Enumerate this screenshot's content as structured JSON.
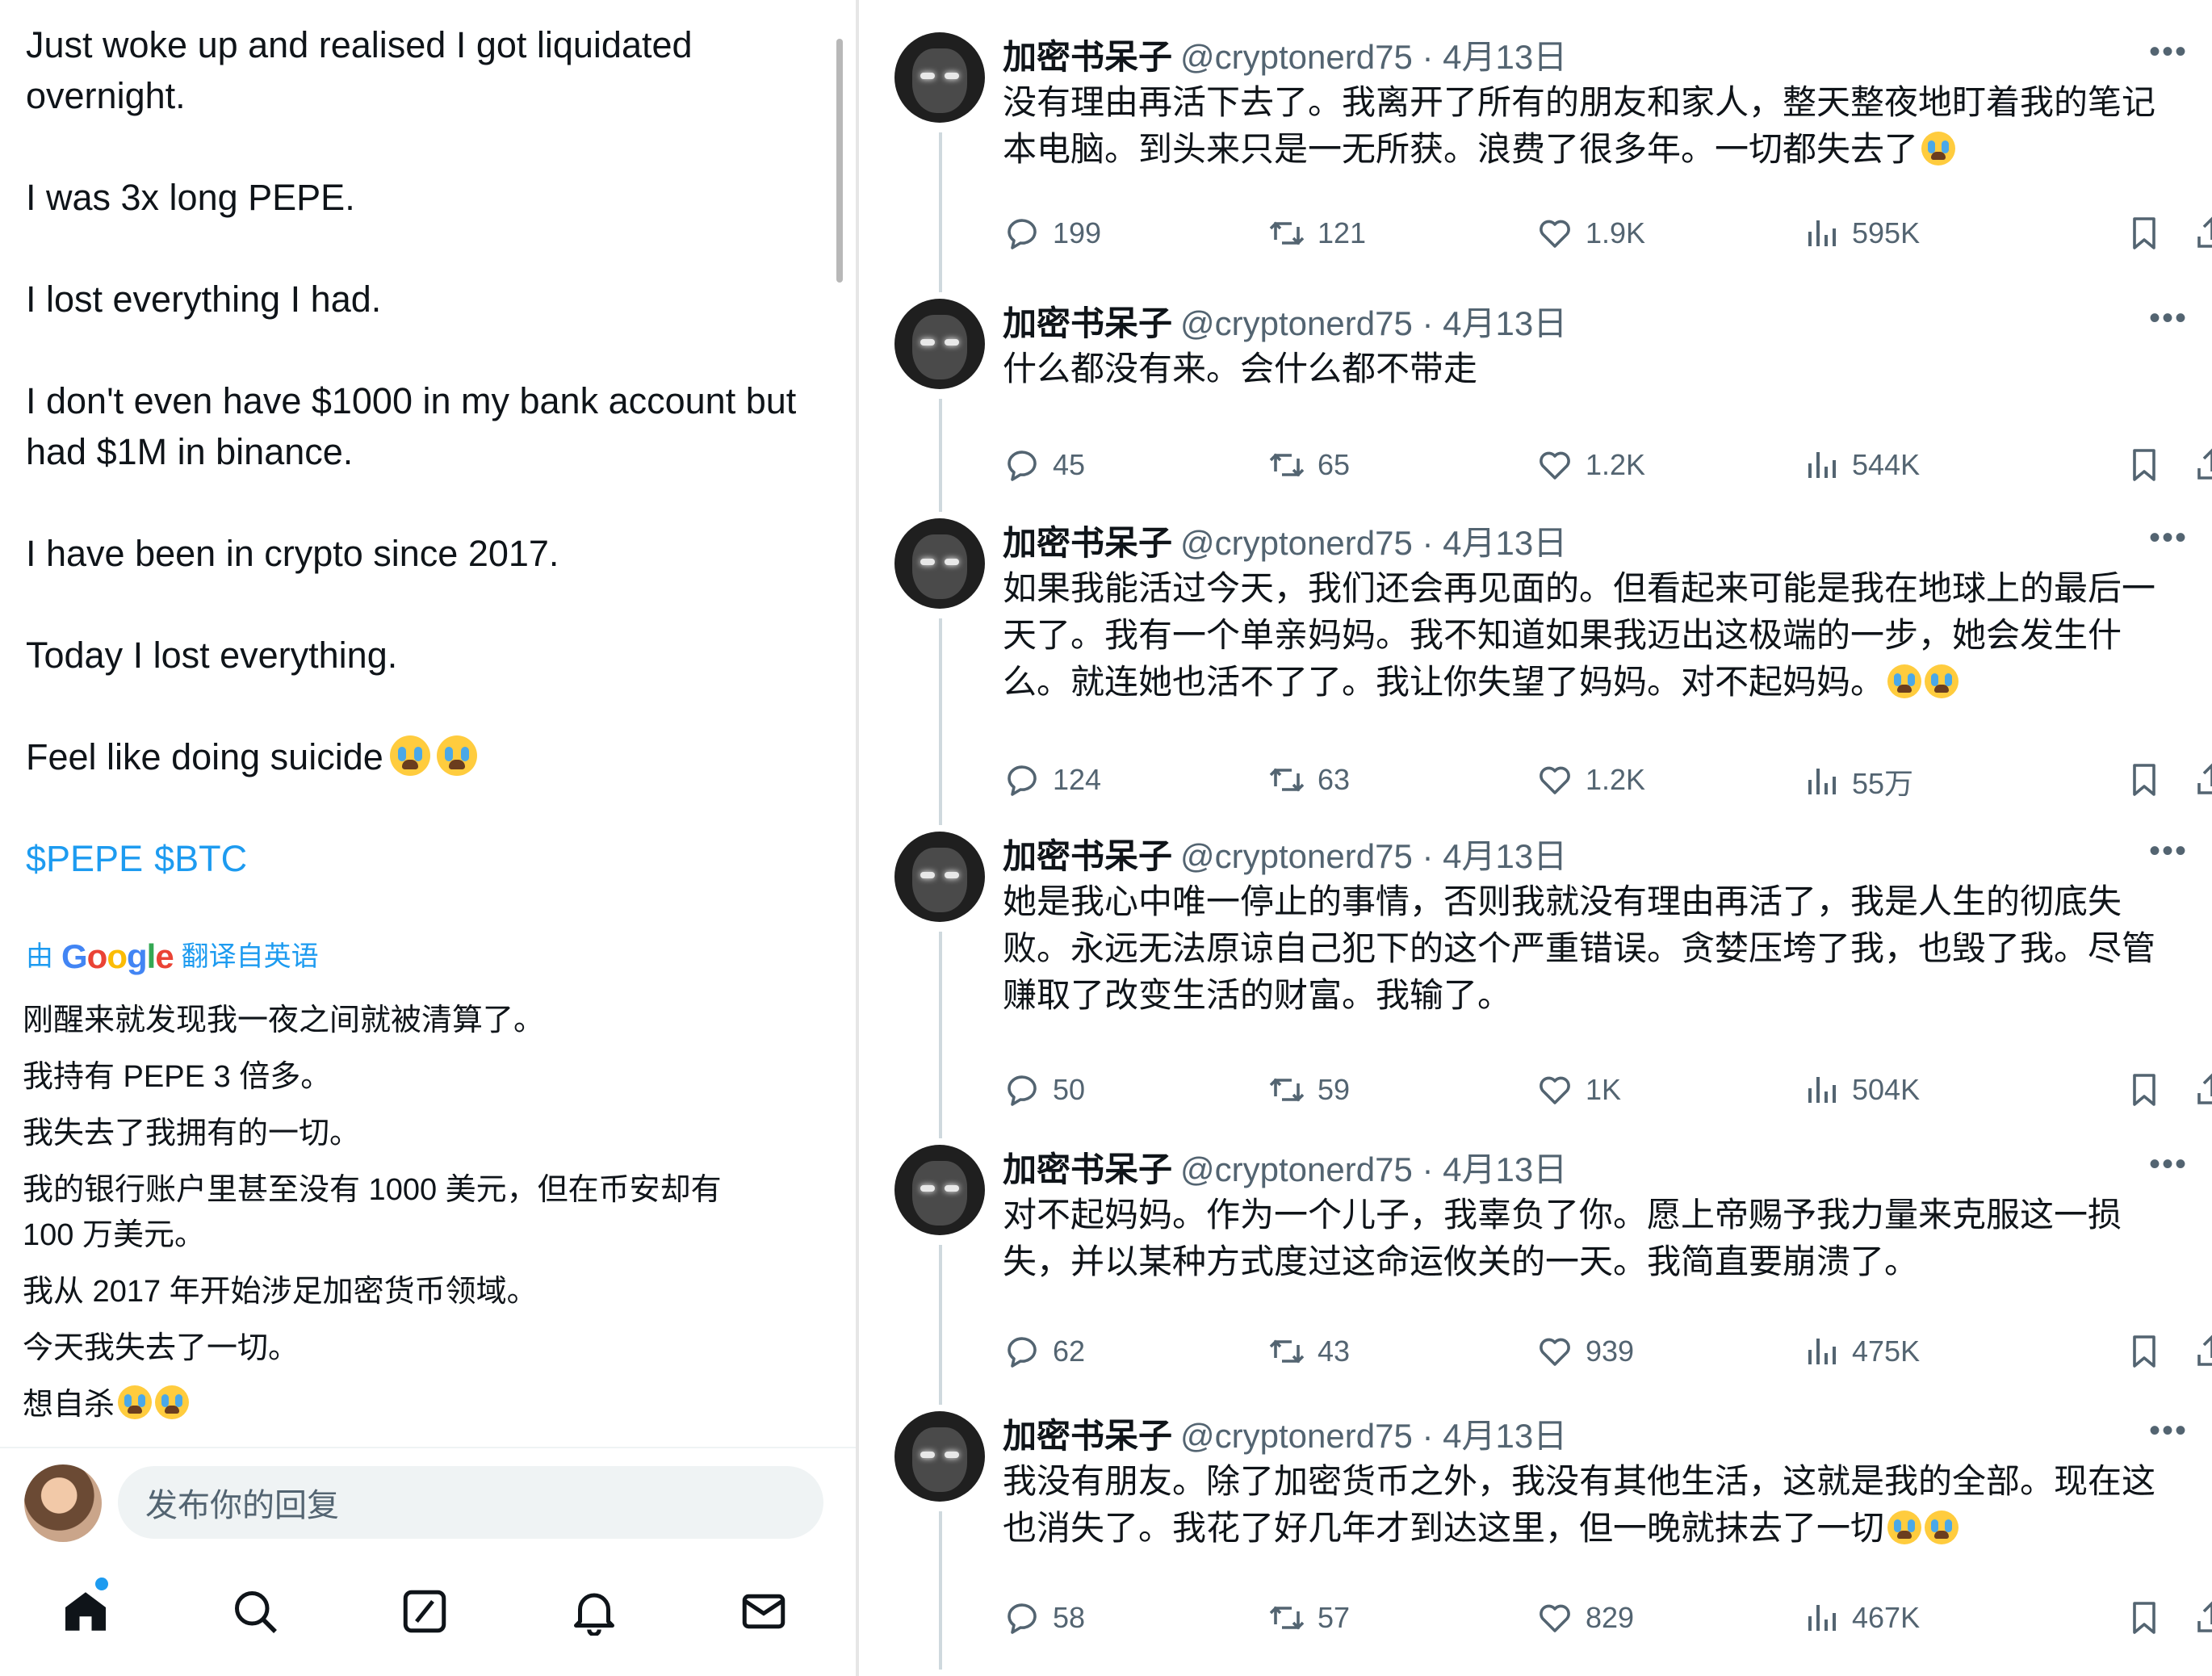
{
  "left": {
    "english_lines": [
      "Just woke up and realised I got liquidated",
      "overnight.",
      "I was 3x long PEPE.",
      "I lost everything I had.",
      "I don't even have $1000 in my bank account but",
      "had $1M in binance.",
      "I have been in crypto since 2017.",
      "Today I lost everything.",
      "Feel like doing suicide"
    ],
    "tags": [
      "$PEPE",
      "$BTC"
    ],
    "translate_prefix": "由",
    "translate_suffix": "翻译自英语",
    "google_letters": [
      "G",
      "o",
      "o",
      "g",
      "l",
      "e"
    ],
    "chinese_lines": [
      "刚醒来就发现我一夜之间就被清算了。",
      "我持有 PEPE 3 倍多。",
      "我失去了我拥有的一切。",
      "我的银行账户里甚至没有 1000 美元，但在币安却有",
      "100 万美元。",
      "我从 2017 年开始涉足加密货币领域。",
      "今天我失去了一切。",
      "想自杀"
    ],
    "reply_placeholder": "发布你的回复",
    "nav": [
      "home-icon",
      "search-icon",
      "compose-icon",
      "notifications-icon",
      "messages-icon"
    ]
  },
  "tweets": [
    {
      "name": "加密书呆子",
      "handle": "@cryptonerd75 · 4月13日",
      "more": "•••",
      "lines": [
        "没有理由再活下去了。我离开了所有的朋友和家人，整天整夜地盯着我的笔记",
        "本电脑。到头来只是一无所获。浪费了很多年。一切都失去了"
      ],
      "emoji_count": 1,
      "replies": "199",
      "retweets": "121",
      "likes": "1.9K",
      "views": "595K"
    },
    {
      "name": "加密书呆子",
      "handle": "@cryptonerd75 · 4月13日",
      "more": "•••",
      "lines": [
        "什么都没有来。会什么都不带走"
      ],
      "emoji_count": 0,
      "replies": "45",
      "retweets": "65",
      "likes": "1.2K",
      "views": "544K"
    },
    {
      "name": "加密书呆子",
      "handle": "@cryptonerd75 · 4月13日",
      "more": "•••",
      "lines": [
        "如果我能活过今天，我们还会再见面的。但看起来可能是我在地球上的最后一",
        "天了。我有一个单亲妈妈。我不知道如果我迈出这极端的一步，她会发生什",
        "么。就连她也活不了了。我让你失望了妈妈。对不起妈妈。"
      ],
      "emoji_count": 2,
      "replies": "124",
      "retweets": "63",
      "likes": "1.2K",
      "views": "55万"
    },
    {
      "name": "加密书呆子",
      "handle": "@cryptonerd75 · 4月13日",
      "more": "•••",
      "lines": [
        "她是我心中唯一停止的事情，否则我就没有理由再活了，我是人生的彻底失",
        "败。永远无法原谅自己犯下的这个严重错误。贪婪压垮了我，也毁了我。尽管",
        "赚取了改变生活的财富。我输了。"
      ],
      "emoji_count": 0,
      "replies": "50",
      "retweets": "59",
      "likes": "1K",
      "views": "504K"
    },
    {
      "name": "加密书呆子",
      "handle": "@cryptonerd75 · 4月13日",
      "more": "•••",
      "lines": [
        "对不起妈妈。作为一个儿子，我辜负了你。愿上帝赐予我力量来克服这一损",
        "失，并以某种方式度过这命运攸关的一天。我简直要崩溃了。"
      ],
      "emoji_count": 0,
      "replies": "62",
      "retweets": "43",
      "likes": "939",
      "views": "475K"
    },
    {
      "name": "加密书呆子",
      "handle": "@cryptonerd75 · 4月13日",
      "more": "•••",
      "lines": [
        "我没有朋友。除了加密货币之外，我没有其他生活，这就是我的全部。现在这",
        "也消失了。我花了好几年才到达这里，但一晚就抹去了一切"
      ],
      "emoji_count": 2,
      "replies": "58",
      "retweets": "57",
      "likes": "829",
      "views": "467K"
    }
  ],
  "colors": {
    "link": "#1d9bf0",
    "text": "#0f1419",
    "muted": "#536471"
  }
}
